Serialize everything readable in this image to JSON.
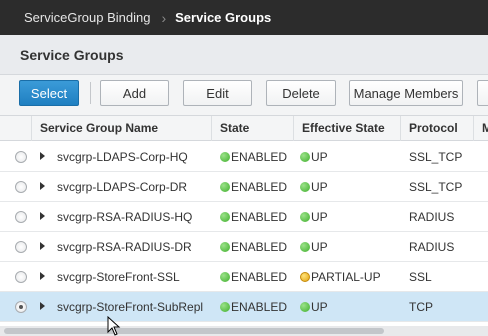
{
  "breadcrumb": {
    "parent": "ServiceGroup Binding",
    "current": "Service Groups"
  },
  "page": {
    "title": "Service Groups"
  },
  "toolbar": {
    "select": "Select",
    "add": "Add",
    "edit": "Edit",
    "delete": "Delete",
    "manage_members": "Manage Members"
  },
  "columns": [
    "Service Group Name",
    "State",
    "Effective State",
    "Protocol",
    "M"
  ],
  "rows": [
    {
      "name": "svcgrp-LDAPS-Corp-HQ",
      "state": "ENABLED",
      "effective": "UP",
      "effective_color": "#3eae2a",
      "protocol": "SSL_TCP"
    },
    {
      "name": "svcgrp-LDAPS-Corp-DR",
      "state": "ENABLED",
      "effective": "UP",
      "effective_color": "#3eae2a",
      "protocol": "SSL_TCP"
    },
    {
      "name": "svcgrp-RSA-RADIUS-HQ",
      "state": "ENABLED",
      "effective": "UP",
      "effective_color": "#3eae2a",
      "protocol": "RADIUS"
    },
    {
      "name": "svcgrp-RSA-RADIUS-DR",
      "state": "ENABLED",
      "effective": "UP",
      "effective_color": "#3eae2a",
      "protocol": "RADIUS"
    },
    {
      "name": "svcgrp-StoreFront-SSL",
      "state": "ENABLED",
      "effective": "PARTIAL-UP",
      "effective_color": "#e3a412",
      "protocol": "SSL"
    },
    {
      "name": "svcgrp-StoreFront-SubRepl",
      "state": "ENABLED",
      "effective": "UP",
      "effective_color": "#3eae2a",
      "protocol": "TCP",
      "selected": true
    }
  ],
  "colors": {
    "topbar": "#2c2c2c",
    "primary_button": "#1f7fc1",
    "selected_row": "#cfe6f6"
  }
}
